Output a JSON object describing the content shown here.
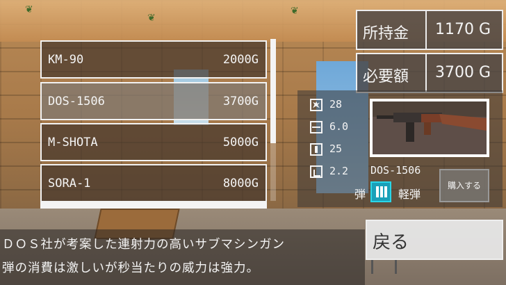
{
  "shop": {
    "items": [
      {
        "name": "KM-90",
        "price": "2000G"
      },
      {
        "name": "DOS-1506",
        "price": "3700G"
      },
      {
        "name": "M-SHOTA",
        "price": "5000G"
      },
      {
        "name": "SORA-1",
        "price": "8000G"
      }
    ],
    "selected_index": 1
  },
  "money": {
    "owned_label": "所持金",
    "owned_value": "1170 G",
    "required_label": "必要額",
    "required_value": "3700 G"
  },
  "stats": {
    "damage": "28",
    "fire_rate": "6.0",
    "magazine": "25",
    "reload": "2.2"
  },
  "weapon": {
    "name": "DOS-1506",
    "ammo_label": "弾",
    "ammo_type": "軽弾",
    "ammo_color": "#1aa0b8"
  },
  "buttons": {
    "buy": "購入する",
    "back": "戻る"
  },
  "description": {
    "line1": "ＤＯＳ社が考案した連射力の高いサブマシンガン",
    "line2": "弾の消費は激しいが秒当たりの威力は強力。"
  }
}
